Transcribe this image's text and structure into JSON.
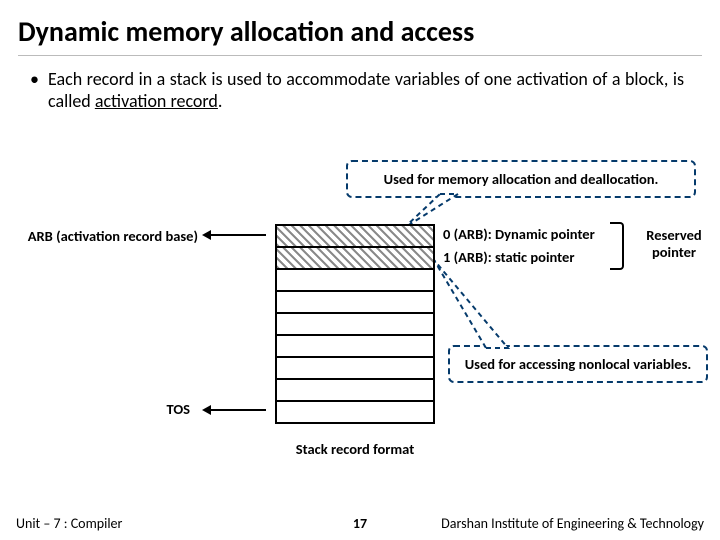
{
  "title": "Dynamic memory allocation and access",
  "bullet": {
    "dot": "•",
    "text_pre": "Each record in a stack is used to accommodate variables of one activation of a block, is called ",
    "text_underlined": "activation record",
    "text_post": "."
  },
  "callout_top": "Used for memory allocation and deallocation.",
  "callout_bottom": "Used for accessing nonlocal variables.",
  "arb_label": "ARB (activation record base)",
  "tos_label": "TOS",
  "row_label_0": "0 (ARB): Dynamic pointer",
  "row_label_1": "1 (ARB): static pointer",
  "reserved_label": "Reserved pointer",
  "caption": "Stack record format",
  "footer": {
    "left": "Unit – 7 : Compiler",
    "page": "17",
    "right": "Darshan Institute of Engineering & Technology"
  }
}
